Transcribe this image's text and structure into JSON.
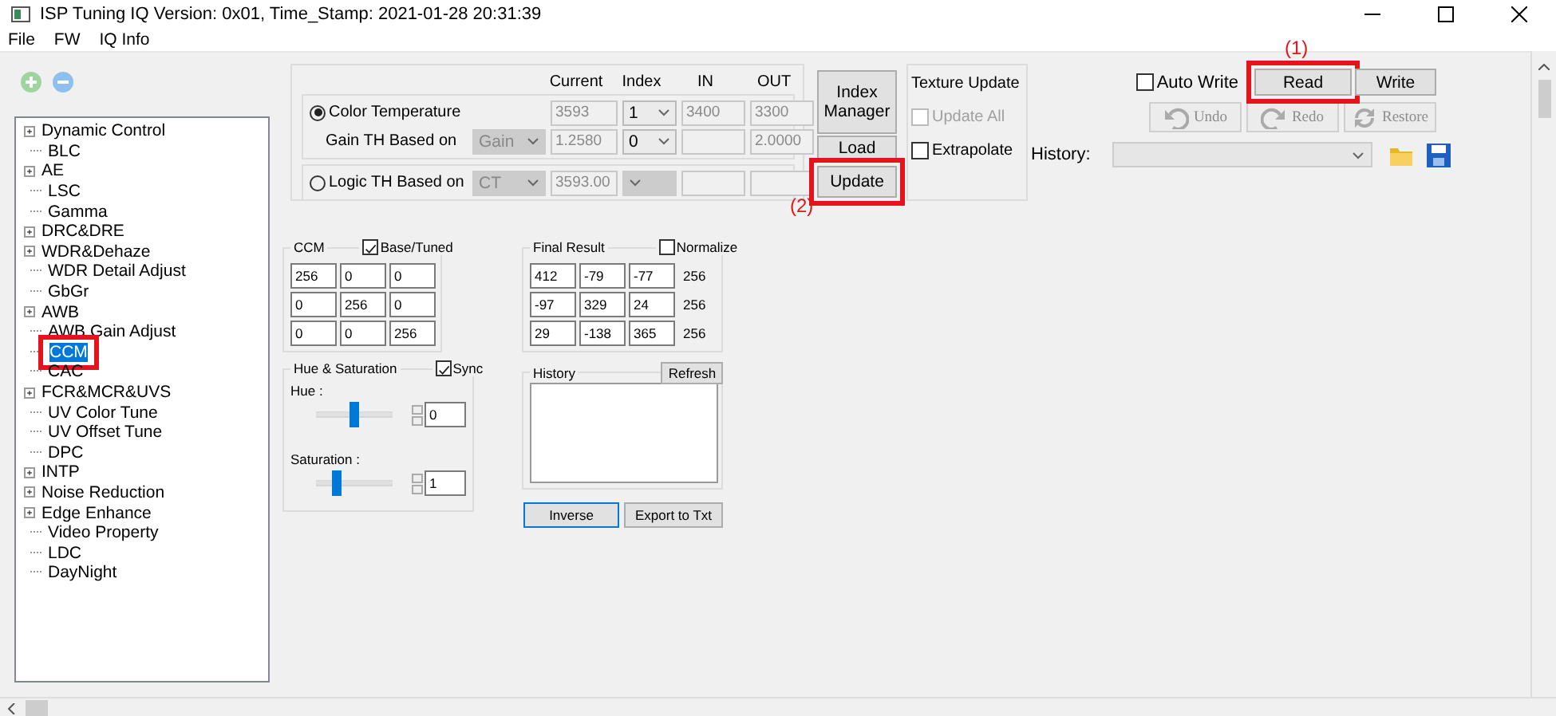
{
  "window": {
    "title": "ISP Tuning IQ Version: 0x01, Time_Stamp: 2021-01-28 20:31:39"
  },
  "menu": [
    "File",
    "FW",
    "IQ Info"
  ],
  "tree": [
    {
      "label": "Dynamic Control",
      "expandable": true,
      "selected": false,
      "highlighted": false
    },
    {
      "label": "BLC",
      "expandable": false,
      "selected": false,
      "highlighted": false
    },
    {
      "label": "AE",
      "expandable": true,
      "selected": false,
      "highlighted": false
    },
    {
      "label": "LSC",
      "expandable": false,
      "selected": false,
      "highlighted": false
    },
    {
      "label": "Gamma",
      "expandable": false,
      "selected": false,
      "highlighted": false
    },
    {
      "label": "DRC&DRE",
      "expandable": true,
      "selected": false,
      "highlighted": false
    },
    {
      "label": "WDR&Dehaze",
      "expandable": true,
      "selected": false,
      "highlighted": false
    },
    {
      "label": "WDR Detail Adjust",
      "expandable": false,
      "selected": false,
      "highlighted": false
    },
    {
      "label": "GbGr",
      "expandable": false,
      "selected": false,
      "highlighted": false
    },
    {
      "label": "AWB",
      "expandable": true,
      "selected": false,
      "highlighted": false
    },
    {
      "label": "AWB Gain Adjust",
      "expandable": false,
      "selected": false,
      "highlighted": false
    },
    {
      "label": "CCM",
      "expandable": false,
      "selected": true,
      "highlighted": true
    },
    {
      "label": "CAC",
      "expandable": false,
      "selected": false,
      "highlighted": false
    },
    {
      "label": "FCR&MCR&UVS",
      "expandable": true,
      "selected": false,
      "highlighted": false
    },
    {
      "label": "UV Color Tune",
      "expandable": false,
      "selected": false,
      "highlighted": false
    },
    {
      "label": "UV Offset Tune",
      "expandable": false,
      "selected": false,
      "highlighted": false
    },
    {
      "label": "DPC",
      "expandable": false,
      "selected": false,
      "highlighted": false
    },
    {
      "label": "INTP",
      "expandable": true,
      "selected": false,
      "highlighted": false
    },
    {
      "label": "Noise Reduction",
      "expandable": true,
      "selected": false,
      "highlighted": false
    },
    {
      "label": "Edge Enhance",
      "expandable": true,
      "selected": false,
      "highlighted": false
    },
    {
      "label": "Video Property",
      "expandable": false,
      "selected": false,
      "highlighted": false
    },
    {
      "label": "LDC",
      "expandable": false,
      "selected": false,
      "highlighted": false
    },
    {
      "label": "DayNight",
      "expandable": false,
      "selected": false,
      "highlighted": false
    }
  ],
  "threshold": {
    "columns": [
      "Current",
      "Index",
      "IN",
      "OUT"
    ],
    "color_temperature": {
      "label": "Color Temperature",
      "selected": true,
      "current": "3593",
      "index": "1",
      "in": "3400",
      "out": "3300"
    },
    "gain_th": {
      "label": "Gain TH Based on",
      "value": "Gain",
      "current": "1.2580",
      "index": "0",
      "out": "2.0000"
    },
    "logic_th": {
      "label": "Logic TH Based on",
      "selected": false,
      "value": "CT",
      "current": "3593.00"
    }
  },
  "side_buttons": [
    {
      "label": "Index Manager",
      "highlighted": false
    },
    {
      "label": "Load",
      "highlighted": false
    },
    {
      "label": "Update",
      "highlighted": true,
      "annotation": "(2)"
    }
  ],
  "texture_update": {
    "title": "Texture Update",
    "options": [
      {
        "label": "Update All",
        "checked": false,
        "disabled": true
      },
      {
        "label": "Extrapolate",
        "checked": false,
        "disabled": false
      }
    ]
  },
  "auto_write": {
    "label": "Auto Write",
    "checked": false
  },
  "device_buttons": [
    {
      "label": "Read",
      "highlighted": true,
      "annotation": "(1)"
    },
    {
      "label": "Write",
      "highlighted": false
    }
  ],
  "edit_buttons": [
    {
      "label": "Undo",
      "kind": "undo",
      "disabled": true
    },
    {
      "label": "Redo",
      "kind": "redo",
      "disabled": true
    },
    {
      "label": "Restore",
      "kind": "restore",
      "disabled": true
    }
  ],
  "history_select": {
    "label": "History:"
  },
  "ccm": {
    "title": "CCM",
    "base_tuned": {
      "label": "Base/Tuned",
      "checked": true
    },
    "matrix": [
      [
        "256",
        "0",
        "0"
      ],
      [
        "0",
        "256",
        "0"
      ],
      [
        "0",
        "0",
        "256"
      ]
    ]
  },
  "hue_saturation": {
    "title": "Hue & Saturation",
    "sync": {
      "label": "Sync",
      "checked": true
    },
    "sliders": [
      {
        "label": "Hue :",
        "level": 0.5,
        "value": "0"
      },
      {
        "label": "Saturation :",
        "level": 0.27,
        "value": "1"
      }
    ]
  },
  "final_result": {
    "title": "Final Result",
    "normalize": {
      "label": "Normalize",
      "checked": false
    },
    "matrix": [
      [
        "412",
        "-79",
        "-77"
      ],
      [
        "-97",
        "329",
        "24"
      ],
      [
        "29",
        "-138",
        "365"
      ]
    ],
    "scale": [
      "256",
      "256",
      "256"
    ]
  },
  "history": {
    "title": "History",
    "refresh": "Refresh"
  },
  "bottom_buttons": [
    {
      "label": "Inverse",
      "focused": true
    },
    {
      "label": "Export to Txt",
      "focused": false
    }
  ]
}
